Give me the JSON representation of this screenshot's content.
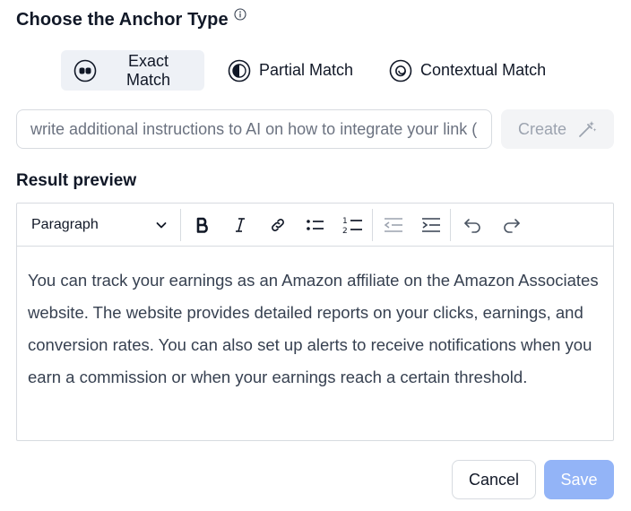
{
  "header": {
    "title": "Choose the Anchor Type",
    "info_icon": "info-icon"
  },
  "anchor_types": [
    {
      "label": "Exact Match",
      "icon": "exact-match-icon",
      "active": true
    },
    {
      "label": "Partial Match",
      "icon": "half-circle-icon",
      "active": false
    },
    {
      "label": "Contextual Match",
      "icon": "spiral-icon",
      "active": false
    }
  ],
  "instructions": {
    "placeholder": "write additional instructions to AI on how to integrate your link (e.g. use the anchor in a sentence)",
    "value": ""
  },
  "create_button": {
    "label": "Create",
    "icon": "magic-wand-icon",
    "disabled": true
  },
  "preview": {
    "title": "Result preview",
    "toolbar": {
      "block_format": "Paragraph",
      "tools": [
        "bold-icon",
        "italic-icon",
        "link-icon",
        "bullet-list-icon",
        "numbered-list-icon",
        "outdent-icon",
        "indent-icon",
        "undo-icon",
        "redo-icon"
      ]
    },
    "content": "You can track your earnings as an Amazon affiliate on the Amazon Associates website. The website provides detailed reports on your clicks, earnings, and conversion rates. You can also set up alerts to receive notifications when you earn a commission or when your earnings reach a certain threshold."
  },
  "footer": {
    "cancel_label": "Cancel",
    "save_label": "Save"
  },
  "colors": {
    "primary_disabled": "#93b4f7",
    "active_bg": "#eef1f6",
    "border": "#d7dbe0"
  }
}
